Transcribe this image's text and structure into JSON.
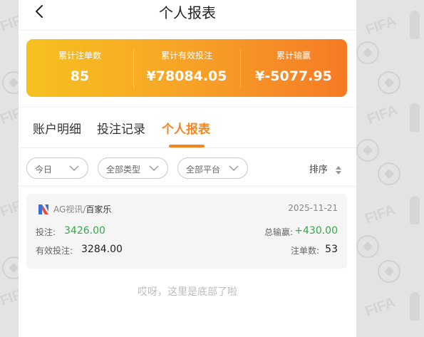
{
  "header": {
    "title": "个人报表",
    "back_icon": "chevron-left-icon"
  },
  "summary": {
    "items": [
      {
        "label": "累计注单数",
        "value": "85"
      },
      {
        "label": "累计有效投注",
        "value": "¥78084.05"
      },
      {
        "label": "累计输赢",
        "value": "¥-5077.95"
      }
    ],
    "gradient": [
      "#f6c11f",
      "#f57a25"
    ]
  },
  "tabs": [
    {
      "label": "账户明细",
      "active": false
    },
    {
      "label": "投注记录",
      "active": false
    },
    {
      "label": "个人报表",
      "active": true
    }
  ],
  "filters": {
    "date": "今日",
    "type": "全部类型",
    "platform": "全部平台",
    "sort": "排序"
  },
  "record": {
    "platform": "AG视讯",
    "separator": "/",
    "game": "百家乐",
    "date": "2025-11-21",
    "bet_label": "投注:",
    "bet_value": "3426.00",
    "winloss_label": "总输赢:",
    "winloss_value": "+430.00",
    "valid_label": "有效投注:",
    "valid_value": "3284.00",
    "count_label": "注单数:",
    "count_value": "53"
  },
  "footer": {
    "text": "哎呀，这里是底部了啦"
  },
  "colors": {
    "accent": "#f5861f",
    "positive": "#3aa64a"
  }
}
